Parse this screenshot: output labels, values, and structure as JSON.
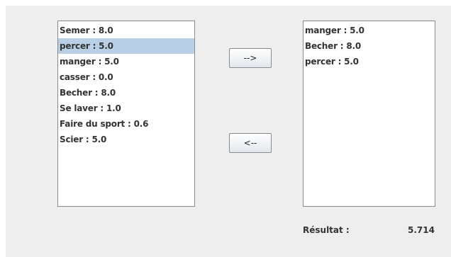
{
  "left_list": {
    "items": [
      {
        "label": "Semer : 8.0",
        "selected": false
      },
      {
        "label": "percer : 5.0",
        "selected": true
      },
      {
        "label": "manger : 5.0",
        "selected": false
      },
      {
        "label": "casser : 0.0",
        "selected": false
      },
      {
        "label": "Becher : 8.0",
        "selected": false
      },
      {
        "label": "Se laver : 1.0",
        "selected": false
      },
      {
        "label": "Faire du sport : 0.6",
        "selected": false
      },
      {
        "label": "Scier : 5.0",
        "selected": false
      }
    ]
  },
  "right_list": {
    "items": [
      {
        "label": "manger : 5.0",
        "selected": false
      },
      {
        "label": "Becher : 8.0",
        "selected": false
      },
      {
        "label": "percer : 5.0",
        "selected": false
      }
    ]
  },
  "buttons": {
    "move_right_label": "-->",
    "move_left_label": "<--"
  },
  "result": {
    "label": "Résultat :",
    "value": "5.714"
  },
  "colors": {
    "panel_background": "#eeeeee",
    "selection": "#b8cfe5",
    "text": "#333333"
  }
}
